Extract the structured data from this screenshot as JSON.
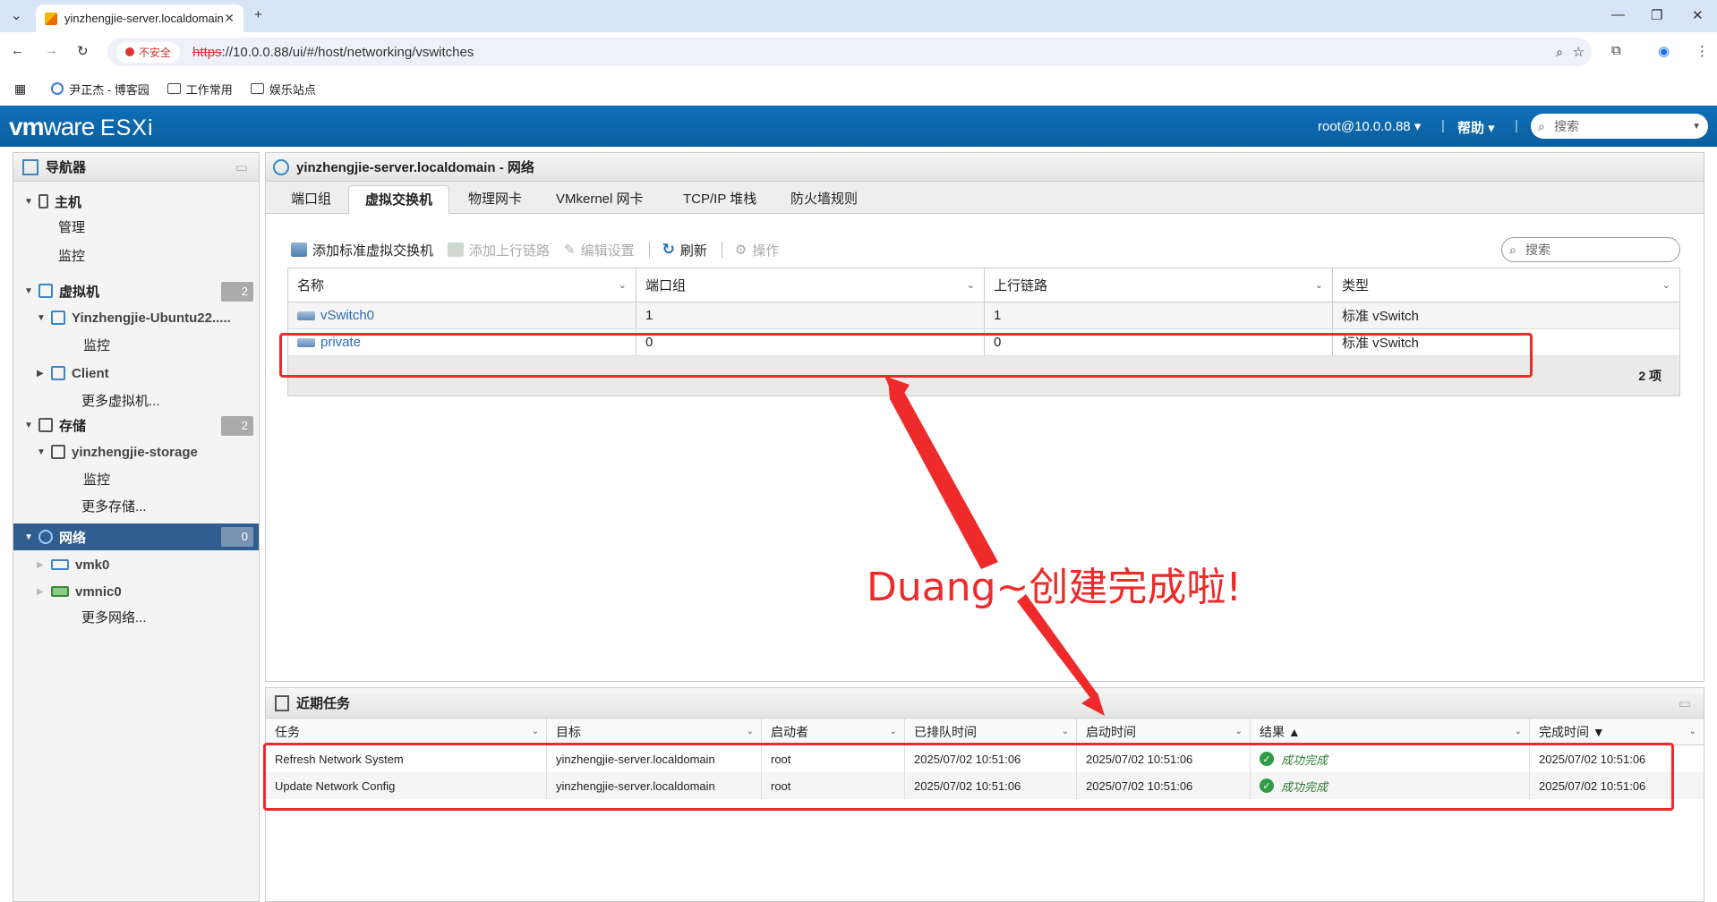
{
  "browser": {
    "tab_title": "yinzhengjie-server.localdomain",
    "insecure": "不安全",
    "url_scheme": "https",
    "url_rest": "://10.0.0.88/ui/#/host/networking/vswitches",
    "bookmarks": [
      "尹正杰 - 博客园",
      "工作常用",
      "娱乐站点"
    ]
  },
  "header": {
    "brand": "vm",
    "brand2": "ware",
    "product": "ESXi",
    "user": "root@10.0.0.88 ▾",
    "help": "帮助 ▾",
    "search": "搜索"
  },
  "nav": {
    "title": "导航器",
    "items": [
      {
        "label": "主机"
      },
      {
        "label": "管理"
      },
      {
        "label": "监控"
      },
      {
        "label": "虚拟机",
        "count": "2"
      },
      {
        "label": "Yinzhengjie-Ubuntu22....."
      },
      {
        "label": "监控"
      },
      {
        "label": "Client"
      },
      {
        "label": "更多虚拟机..."
      },
      {
        "label": "存储",
        "count": "2"
      },
      {
        "label": "yinzhengjie-storage"
      },
      {
        "label": "监控"
      },
      {
        "label": "更多存储..."
      },
      {
        "label": "网络",
        "count": "0"
      },
      {
        "label": "vmk0"
      },
      {
        "label": "vmnic0"
      },
      {
        "label": "更多网络..."
      }
    ]
  },
  "main": {
    "title": "yinzhengjie-server.localdomain - 网络",
    "tabs": [
      "端口组",
      "虚拟交换机",
      "物理网卡",
      "VMkernel 网卡",
      "TCP/IP 堆栈",
      "防火墙规则"
    ],
    "toolbar": {
      "add": "添加标准虚拟交换机",
      "uplink": "添加上行链路",
      "edit": "编辑设置",
      "refresh": "刷新",
      "actions": "操作"
    },
    "search": "搜索",
    "columns": [
      "名称",
      "端口组",
      "上行链路",
      "类型"
    ],
    "rows": [
      {
        "name": "vSwitch0",
        "ports": "1",
        "uplinks": "1",
        "type": "标准 vSwitch"
      },
      {
        "name": "private",
        "ports": "0",
        "uplinks": "0",
        "type": "标准 vSwitch"
      }
    ],
    "count": "2 项"
  },
  "tasks": {
    "title": "近期任务",
    "columns": [
      "任务",
      "目标",
      "启动者",
      "已排队时间",
      "启动时间",
      "结果 ▲",
      "完成时间 ▼"
    ],
    "rows": [
      {
        "task": "Refresh Network System",
        "target": "yinzhengjie-server.localdomain",
        "initiator": "root",
        "queued": "2025/07/02 10:51:06",
        "started": "2025/07/02 10:51:06",
        "result": "成功完成",
        "completed": "2025/07/02 10:51:06"
      },
      {
        "task": "Update Network Config",
        "target": "yinzhengjie-server.localdomain",
        "initiator": "root",
        "queued": "2025/07/02 10:51:06",
        "started": "2025/07/02 10:51:06",
        "result": "成功完成",
        "completed": "2025/07/02 10:51:06"
      }
    ]
  },
  "annotation": "Duang~创建完成啦!",
  "colors": {
    "accent": "#0f6fb6",
    "annot": "#ee2a2a",
    "selected": "#325e8f"
  }
}
